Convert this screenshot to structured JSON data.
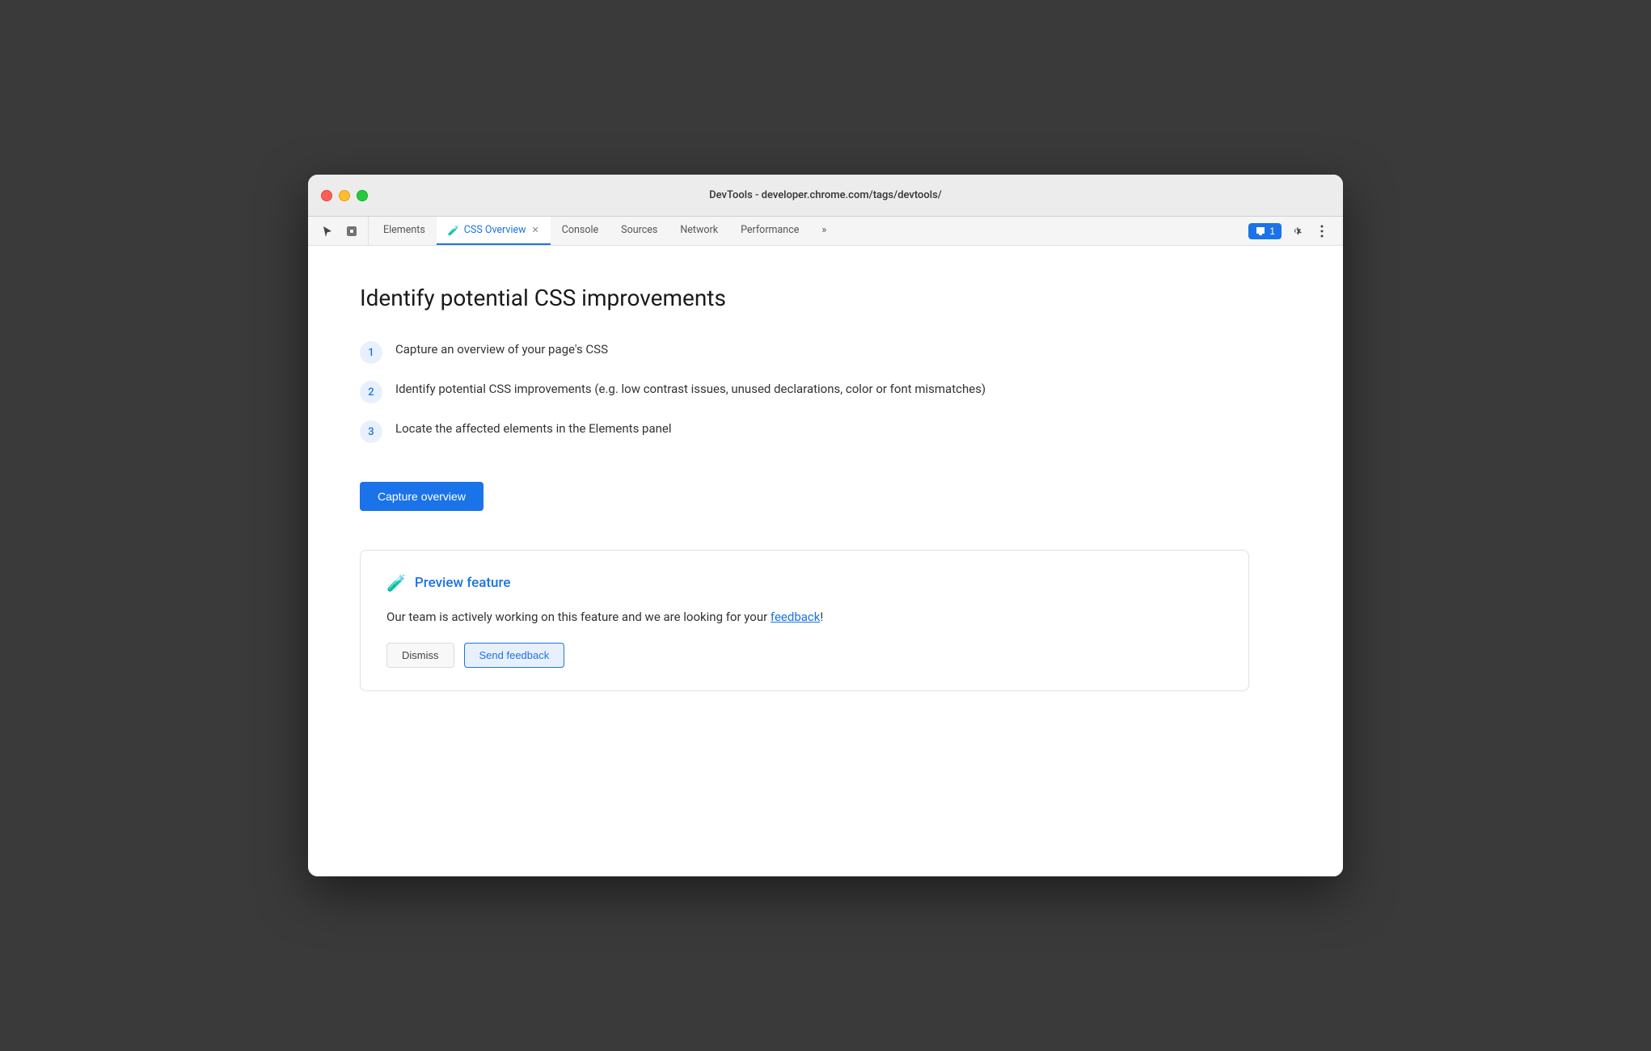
{
  "window": {
    "title": "DevTools - developer.chrome.com/tags/devtools/"
  },
  "titlebar": {
    "url": "DevTools - developer.chrome.com/tags/devtools/",
    "traffic_lights": {
      "close": "close",
      "minimize": "minimize",
      "maximize": "maximize"
    }
  },
  "toolbar": {
    "tabs": [
      {
        "id": "elements",
        "label": "Elements",
        "active": false
      },
      {
        "id": "css-overview",
        "label": "CSS Overview",
        "active": true,
        "has_icon": true,
        "has_close": true
      },
      {
        "id": "console",
        "label": "Console",
        "active": false
      },
      {
        "id": "sources",
        "label": "Sources",
        "active": false
      },
      {
        "id": "network",
        "label": "Network",
        "active": false
      },
      {
        "id": "performance",
        "label": "Performance",
        "active": false
      },
      {
        "id": "more",
        "label": "»",
        "active": false
      }
    ],
    "badge_count": "1",
    "cursor_icon": "⬚",
    "layers_icon": "⧉",
    "settings_icon": "⚙",
    "more_icon": "⋮"
  },
  "main": {
    "page_title": "Identify potential CSS improvements",
    "steps": [
      {
        "number": "1",
        "text": "Capture an overview of your page's CSS"
      },
      {
        "number": "2",
        "text": "Identify potential CSS improvements (e.g. low contrast issues, unused declarations, color or font mismatches)"
      },
      {
        "number": "3",
        "text": "Locate the affected elements in the Elements panel"
      }
    ],
    "capture_button": "Capture overview",
    "preview_card": {
      "icon": "🧪",
      "title": "Preview feature",
      "text_before_link": "Our team is actively working on this feature and we are looking for your ",
      "link_text": "feedback",
      "text_after_link": "!",
      "btn1_label": "Dismiss",
      "btn2_label": "Send feedback"
    }
  }
}
